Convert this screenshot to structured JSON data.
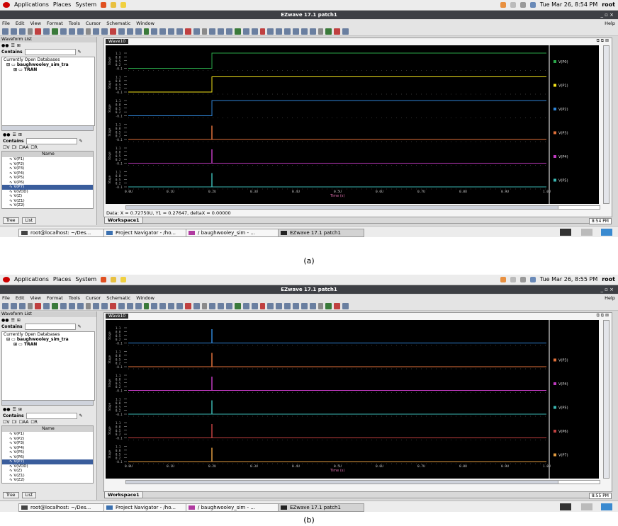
{
  "screens": [
    {
      "clock": "Tue Mar 26,  8:54 PM",
      "status_time": "8:54 PM",
      "data_line": "Data: X = 0.72750U,  Y1 = 0.27647,  deltaX = 0.00000",
      "legend": [
        "V(P0)",
        "V(P1)",
        "V(P2)",
        "V(P3)",
        "V(P4)",
        "V(P5)"
      ],
      "legend_colors": [
        "#2aa84a",
        "#f2e21a",
        "#2f84d6",
        "#e0703a",
        "#c03ac0",
        "#3ab5b0"
      ],
      "step_x_percent": 20,
      "caption": "(a)"
    },
    {
      "clock": "Tue Mar 26,  8:55 PM",
      "status_time": "8:55 PM",
      "data_line": "",
      "legend": [
        "",
        "V(P3)",
        "V(P4)",
        "V(P5)",
        "V(P6)",
        "V(P7)"
      ],
      "legend_colors": [
        "#2f84d6",
        "#e0703a",
        "#c03ac0",
        "#3ab5b0",
        "#c04040",
        "#e09a40"
      ],
      "step_x_percent": 20,
      "caption": "(b)"
    }
  ],
  "panel": {
    "applications": "Applications",
    "places": "Places",
    "system": "System",
    "user": "root"
  },
  "window_title": "EZwave 17.1 patch1",
  "menu": [
    "File",
    "Edit",
    "View",
    "Format",
    "Tools",
    "Cursor",
    "Schematic",
    "Window",
    "Help"
  ],
  "sidebar": {
    "title": "Waveform List",
    "contains_label": "Contains",
    "open_db_label": "Currently Open Databases",
    "db_name": "baughwooley_sim_tra",
    "tran_label": "TRAN",
    "filters": [
      "V",
      "I",
      "AA",
      "R"
    ],
    "name_header": "Name",
    "names": [
      "V(P1)",
      "V(P2)",
      "V(P3)",
      "V(P4)",
      "V(P5)",
      "V(P6)",
      "V(P7)",
      "V(VDD)",
      "V(Z)",
      "V(Z1)",
      "V(Z2)"
    ],
    "selected_name": "V(P7)",
    "tab_tree": "Tree",
    "tab_list": "List"
  },
  "wave_window": {
    "title": "Wave10",
    "y_ticks": [
      "1.1",
      "0.8",
      "0.5",
      "0.2",
      "-0.1"
    ],
    "x_ticks": [
      "0.0U",
      "0.1U",
      "0.2U",
      "0.3U",
      "0.4U",
      "0.5U",
      "0.6U",
      "0.7U",
      "0.8U",
      "0.9U",
      "1.0U"
    ],
    "x_label": "Time (s)",
    "y_label": "Stage"
  },
  "workspace_tab": "Workspace1",
  "tasks": [
    "root@localhost: ~/Des...",
    "Project Navigator - /ho...",
    "/ baughwooley_sim  - ...",
    "EZwave 17.1 patch1"
  ],
  "chart_data": [
    {
      "type": "line",
      "title": "Wave10",
      "xlabel": "Time (s)",
      "series": [
        {
          "name": "V(P0)",
          "x": [
            0,
            0.2,
            0.2,
            1.0
          ],
          "y": [
            0,
            0,
            1.1,
            1.1
          ]
        },
        {
          "name": "V(P1)",
          "x": [
            0,
            0.2,
            0.2,
            1.0
          ],
          "y": [
            0,
            0,
            1.1,
            1.1
          ]
        },
        {
          "name": "V(P2)",
          "x": [
            0,
            0.2,
            0.2,
            1.0
          ],
          "y": [
            0,
            0,
            1.1,
            1.1
          ]
        },
        {
          "name": "V(P3)",
          "x": [
            0,
            0.2,
            1.0
          ],
          "y": [
            0,
            0,
            0
          ]
        },
        {
          "name": "V(P4)",
          "x": [
            0,
            0.2,
            1.0
          ],
          "y": [
            0,
            0,
            0
          ]
        },
        {
          "name": "V(P5)",
          "x": [
            0,
            0.2,
            1.0
          ],
          "y": [
            0,
            0,
            0
          ]
        }
      ],
      "xlim": [
        0,
        1.0
      ],
      "ylim": [
        -0.1,
        1.1
      ]
    },
    {
      "type": "line",
      "title": "Wave10",
      "xlabel": "Time (s)",
      "series": [
        {
          "name": "V(P3)",
          "x": [
            0,
            0.2,
            1.0
          ],
          "y": [
            0,
            0,
            0
          ]
        },
        {
          "name": "V(P4)",
          "x": [
            0,
            0.2,
            1.0
          ],
          "y": [
            0,
            0,
            0
          ]
        },
        {
          "name": "V(P5)",
          "x": [
            0,
            0.2,
            1.0
          ],
          "y": [
            0,
            0,
            0
          ]
        },
        {
          "name": "V(P6)",
          "x": [
            0,
            0.2,
            1.0
          ],
          "y": [
            0,
            0,
            0
          ]
        },
        {
          "name": "V(P7)",
          "x": [
            0,
            0.2,
            1.0
          ],
          "y": [
            0,
            0,
            0
          ]
        }
      ],
      "xlim": [
        0,
        1.0
      ],
      "ylim": [
        -0.1,
        1.1
      ]
    }
  ]
}
